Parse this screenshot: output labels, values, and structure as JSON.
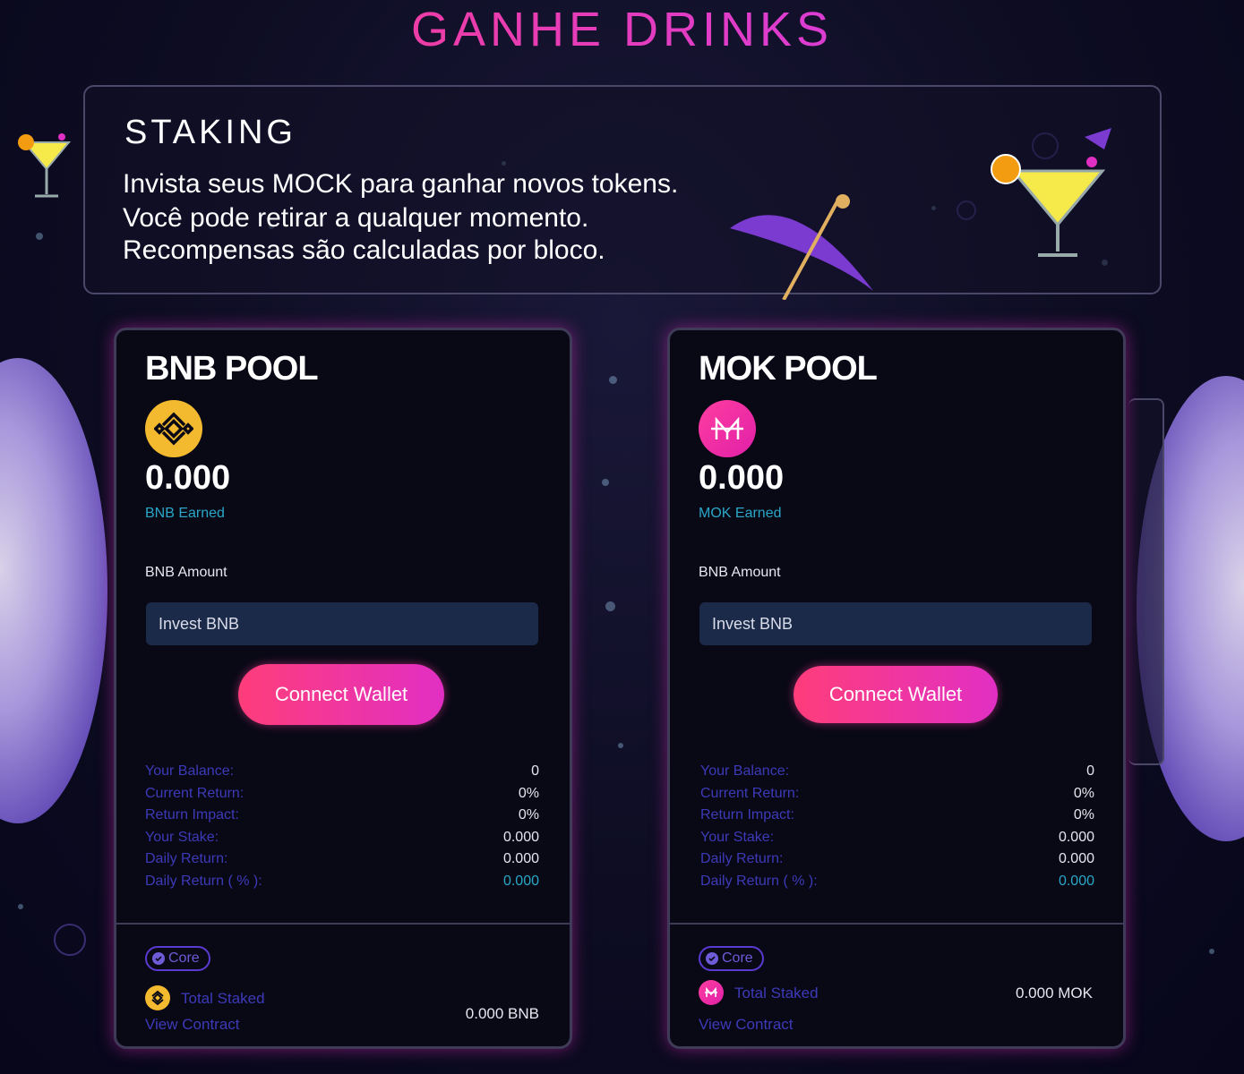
{
  "header": {
    "title": "GANHE DRINKS"
  },
  "info": {
    "title": "STAKING",
    "lines": [
      "Invista seus MOCK para ganhar novos tokens.",
      "Você pode retirar a qualquer momento.",
      "Recompensas são calculadas por bloco."
    ]
  },
  "pools": [
    {
      "title": "BNB POOL",
      "coin_icon": "bnb-icon",
      "earned_value": "0.000",
      "earned_label": "BNB Earned",
      "amount_label": "BNB Amount",
      "input_placeholder": "Invest BNB",
      "connect_label": "Connect Wallet",
      "stats": [
        {
          "label": "Your Balance:",
          "value": "0"
        },
        {
          "label": "Current Return:",
          "value": "0%"
        },
        {
          "label": "Return Impact:",
          "value": "0%"
        },
        {
          "label": "Your Stake:",
          "value": "0.000"
        },
        {
          "label": "Daily Return:",
          "value": "0.000"
        },
        {
          "label": "Daily Return ( % ):",
          "value": "0.000"
        }
      ],
      "core_label": "Core",
      "total_staked_label": "Total Staked",
      "total_staked_value": "0.000 BNB",
      "view_contract": "View Contract"
    },
    {
      "title": "MOK POOL",
      "coin_icon": "mok-icon",
      "earned_value": "0.000",
      "earned_label": "MOK Earned",
      "amount_label": "BNB Amount",
      "input_placeholder": "Invest BNB",
      "connect_label": "Connect Wallet",
      "stats": [
        {
          "label": "Your Balance:",
          "value": "0"
        },
        {
          "label": "Current Return:",
          "value": "0%"
        },
        {
          "label": "Return Impact:",
          "value": "0%"
        },
        {
          "label": "Your Stake:",
          "value": "0.000"
        },
        {
          "label": "Daily Return:",
          "value": "0.000"
        },
        {
          "label": "Daily Return ( % ):",
          "value": "0.000"
        }
      ],
      "core_label": "Core",
      "total_staked_label": "Total Staked",
      "total_staked_value": "0.000 MOK",
      "view_contract": "View Contract"
    }
  ],
  "colors": {
    "accent_pink": "#ff3d7a",
    "accent_purple": "#c93cff",
    "link_blue": "#3d3ab8",
    "earned_cyan": "#2aa7c8",
    "bnb_gold": "#f3ba2f"
  }
}
